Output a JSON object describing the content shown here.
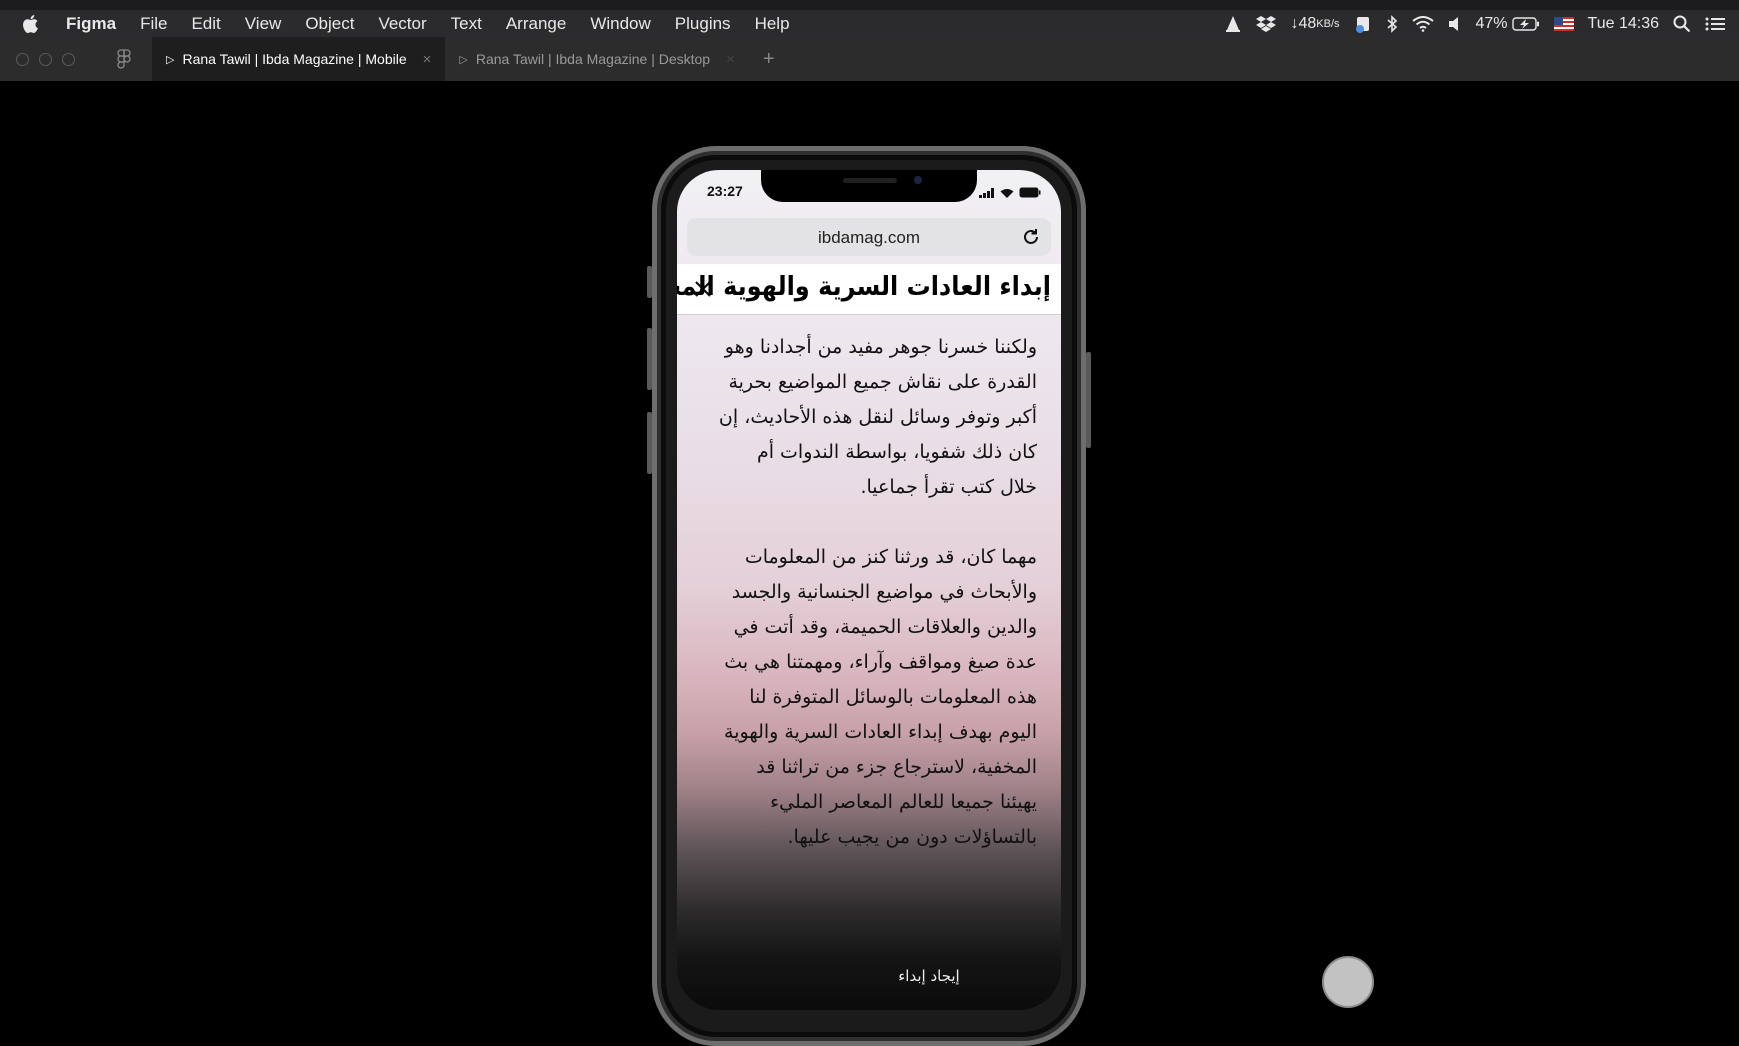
{
  "menubar": {
    "app_name": "Figma",
    "menus": [
      "File",
      "Edit",
      "View",
      "Object",
      "Vector",
      "Text",
      "Arrange",
      "Window",
      "Plugins",
      "Help"
    ],
    "net_speed": "↓48",
    "net_unit": "KB/s",
    "battery": "47%",
    "clock": "Tue 14:36",
    "icons": [
      "apple-icon",
      "vlc-icon",
      "dropbox-icon",
      "bluetooth-icon",
      "wifi-icon",
      "volume-icon",
      "battery-charging-icon",
      "us-flag-icon",
      "spotlight-search-icon",
      "notification-center-icon"
    ]
  },
  "tabs": [
    {
      "label": "Rana Tawil | Ibda Magazine | Mobile",
      "active": true
    },
    {
      "label": "Rana Tawil | Ibda Magazine | Desktop",
      "active": false
    }
  ],
  "phone": {
    "time": "23:27",
    "url": "ibdamag.com",
    "header_title": "إبداء العادات السرية والهوية المخفية",
    "paragraphs": [
      "ولكننا خسرنا جوهر مفيد من أجدادنا وهو القدرة على نقاش جميع المواضيع بحرية أكبر وتوفر وسائل لنقل هذه الأحاديث، إن كان ذلك شفويا، بواسطة الندوات أم خلال كتب تقرأ جماعيا.",
      "مهما كان، قد ورثنا كنز من المعلومات والأبحاث في مواضيع الجنسانية والجسد والدين والعلاقات الحميمة، وقد أتت في عدة صيغ ومواقف وآراء، ومهمتنا هي بث هذه المعلومات بالوسائل المتوفرة لنا اليوم بهدف إبداء العادات السرية والهوية المخفية، لاسترجاع جزء من تراثنا قد يهيئنا جميعا للعالم المعاصر المليء بالتساؤلات دون من يجيب عليها."
    ],
    "bottom_link": "إيجاد إبداء"
  }
}
